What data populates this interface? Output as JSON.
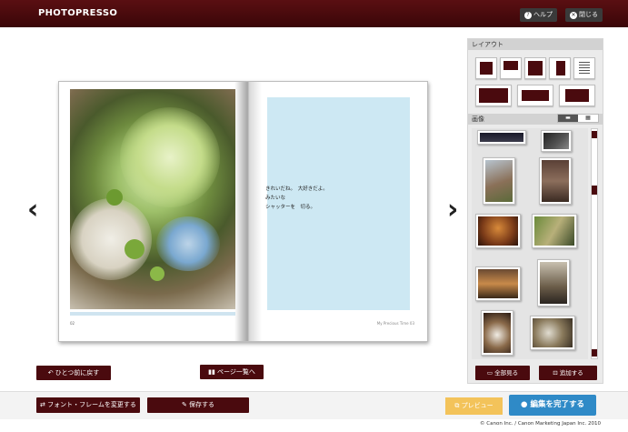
{
  "header": {
    "logo": "PHOTOPRESSO",
    "help_label": "ヘルプ",
    "close_label": "閉じる"
  },
  "book": {
    "caption_lines": [
      "きれいだね。　大好きだよ。",
      "みたいな",
      "シャッターを　切る。"
    ],
    "left_page_number": "02",
    "right_page_footer": "My Precious Time 03"
  },
  "navigation": {
    "prev": "‹",
    "next": "›"
  },
  "panel": {
    "layout_title": "レイアウト",
    "image_title": "画像",
    "view_all_label": "全部見る",
    "add_label": "追加する"
  },
  "actions": {
    "undo_label": "ひとつ前に戻す",
    "page_list_label": "ページ一覧へ",
    "change_font_frame_label": "フォント・フレームを変更する",
    "save_label": "保存する",
    "preview_label": "プレビュー",
    "finish_label": "編集を完了する"
  },
  "footer": {
    "copyright": "© Canon Inc. / Canon Marketing Japan Inc. 2010"
  },
  "colors": {
    "accent": "#4a0a0e",
    "finish": "#2f8ac7",
    "preview": "#f3c35a",
    "text_frame": "#cde8f3"
  }
}
